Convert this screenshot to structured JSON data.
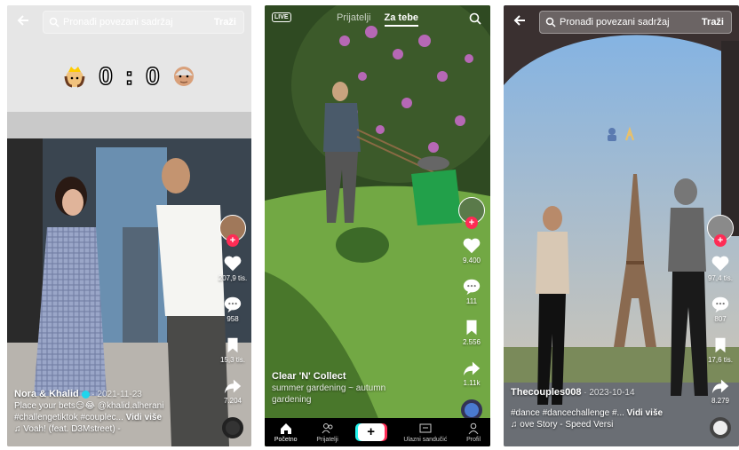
{
  "panel1": {
    "search": {
      "query": "Pronađi povezani sadržaj",
      "button": "Traži"
    },
    "score": {
      "left": "0",
      "sep": ":",
      "right": "0"
    },
    "counts": {
      "likes": "207,9 tis.",
      "comments": "958",
      "saves": "15,3 tis.",
      "shares": "7.204"
    },
    "caption": {
      "user": "Nora & Khalid",
      "date": "· 2021-11-23",
      "line1": "Place your bets😏😂 @khalid.alherani",
      "line2": "#challengetiktok #couplec...",
      "more": "Vidi više",
      "music": "♫ Voah! (feat. D3Mstreet) -"
    }
  },
  "panel2": {
    "live_label": "LIVE",
    "tabs": {
      "following": "Prijatelji",
      "foryou": "Za tebe"
    },
    "counts": {
      "likes": "9.400",
      "comments": "111",
      "saves": "2.556",
      "shares": "1.11k"
    },
    "caption": {
      "user": "Clear 'N' Collect",
      "line1": "summer gardening ~ autumn",
      "line2": "gardening"
    },
    "nav": {
      "home": "Početno",
      "friends": "Prijatelji",
      "create": "+",
      "inbox": "Ulazni sandučić",
      "profile": "Profil"
    }
  },
  "panel3": {
    "search": {
      "query": "Pronađi povezani sadržaj",
      "button": "Traži"
    },
    "counts": {
      "likes": "97,4 tis.",
      "comments": "807",
      "saves": "17,6 tis.",
      "shares": "8.279"
    },
    "caption": {
      "user": "Thecouples008",
      "date": "· 2023-10-14",
      "line1": "#dance #dancechallenge #...",
      "more": "Vidi više",
      "music": "♫ ove Story - Speed Versi"
    }
  },
  "colors": {
    "accent": "#fe2c55",
    "tiktok_cyan": "#25f4ee",
    "like": "#ffffff"
  }
}
